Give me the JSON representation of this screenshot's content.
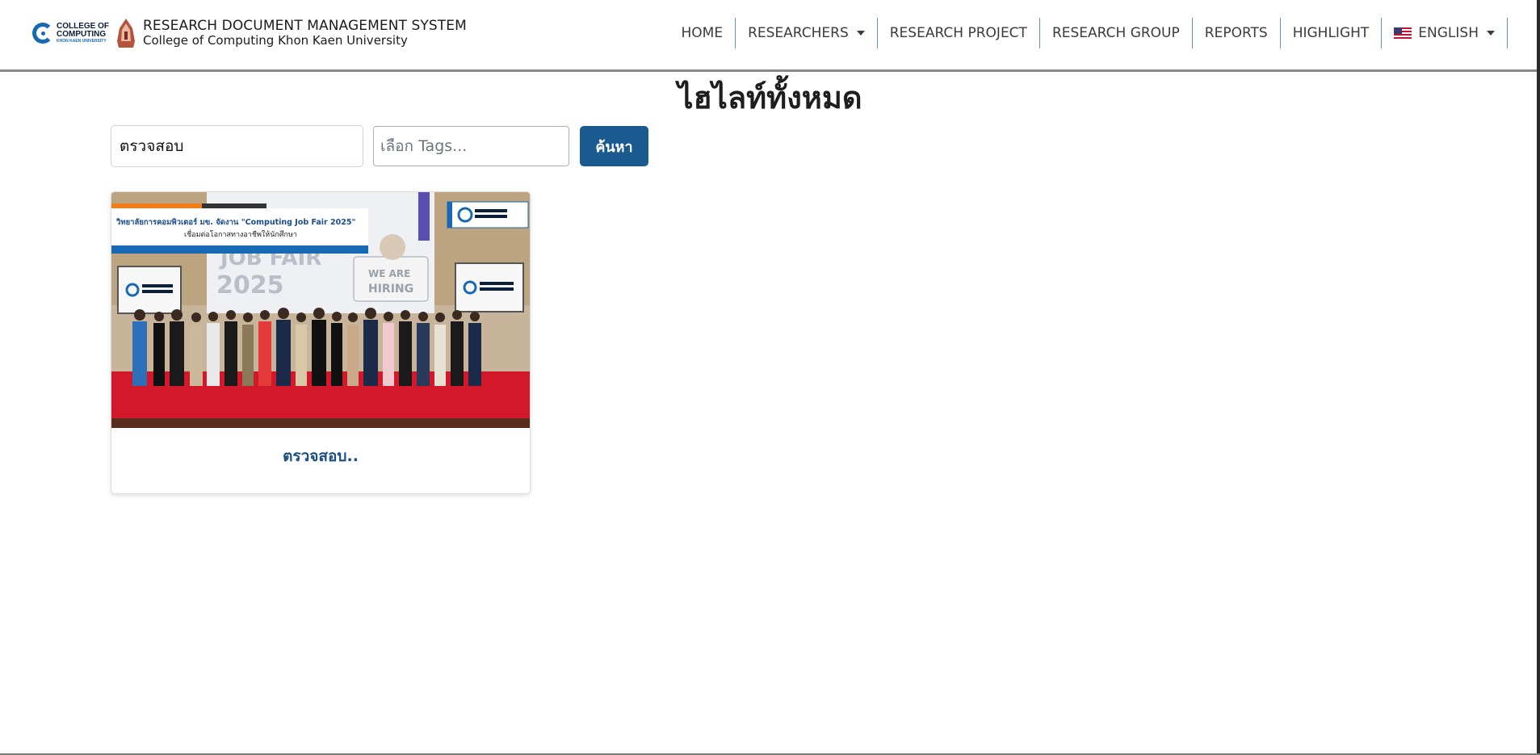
{
  "brand": {
    "logo_line1": "COLLEGE OF",
    "logo_line2": "COMPUTING",
    "logo_line3": "KHON KAEN UNIVERSITY",
    "title": "RESEARCH DOCUMENT MANAGEMENT SYSTEM",
    "subtitle": "College of Computing Khon Kaen University"
  },
  "nav": {
    "home": "HOME",
    "researchers": "RESEARCHERS",
    "research_project": "RESEARCH PROJECT",
    "research_group": "RESEARCH GROUP",
    "reports": "REPORTS",
    "highlight": "HIGHLIGHT",
    "language": "ENGLISH"
  },
  "page": {
    "title": "ไฮไลท์ทั้งหมด"
  },
  "search": {
    "value": "ตรวจสอบ",
    "tags_placeholder": "เลือก Tags...",
    "button_label": "ค้นหา"
  },
  "cards": [
    {
      "caption": "ตรวจสอบ..",
      "image": {
        "banner_title": "วิทยาลัยการคอมพิวเตอร์ มข. จัดงาน \"Computing Job Fair 2025\"",
        "banner_subtitle": "เชื่อมต่อโอกาสทางอาชีพให้นักศึกษา",
        "screen_text_1": "JOB FAIR",
        "screen_text_2": "2025",
        "sign_text_1": "WE ARE",
        "sign_text_2": "HIRING"
      }
    }
  ],
  "colors": {
    "primary_button": "#1a5a8e",
    "caption": "#1c4f80",
    "logo_blue": "#1769b3",
    "carpet_red": "#d3182a"
  }
}
